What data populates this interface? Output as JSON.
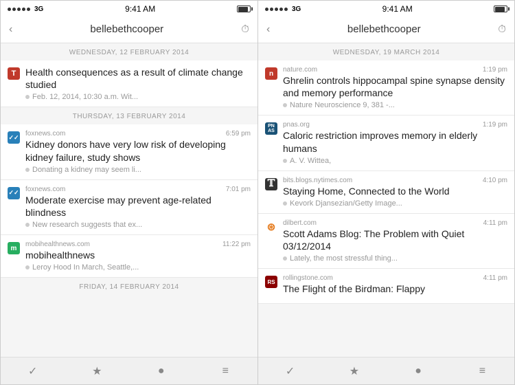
{
  "phone_left": {
    "status": {
      "signal_dots": 5,
      "network": "3G",
      "time": "9:41 AM"
    },
    "nav": {
      "back_label": "‹",
      "title": "bellebethcooper",
      "clock_icon": "⏱"
    },
    "sections": [
      {
        "date": "WEDNESDAY, 12 FEBRUARY 2014",
        "items": [
          {
            "icon_type": "red",
            "icon_label": "T",
            "source": "",
            "time": "",
            "title": "Health consequences as a result of climate change studied",
            "snippet": "Feb. 12, 2014, 10:30 a.m. Wit..."
          }
        ]
      },
      {
        "date": "THURSDAY, 13 FEBRUARY 2014",
        "items": [
          {
            "icon_type": "blue",
            "icon_label": "✓",
            "source": "foxnews.com",
            "time": "6:59 pm",
            "title": "Kidney donors have very low risk of developing kidney failure, study shows",
            "snippet": "Donating a kidney may seem li..."
          },
          {
            "icon_type": "blue",
            "icon_label": "✓",
            "source": "foxnews.com",
            "time": "7:01 pm",
            "title": "Moderate exercise may prevent age-related blindness",
            "snippet": "New research suggests that ex..."
          },
          {
            "icon_type": "green",
            "icon_label": "m",
            "source": "mobihealthnews.com",
            "time": "11:22 pm",
            "title": "mobihealthnews",
            "snippet": "Leroy Hood In March, Seattle,..."
          }
        ]
      },
      {
        "date": "FRIDAY, 14 FEBRUARY 2014",
        "items": []
      }
    ],
    "toolbar": {
      "check": "✓",
      "star": "★",
      "dot": "●",
      "menu": "≡"
    }
  },
  "phone_right": {
    "status": {
      "signal_dots": 5,
      "network": "3G",
      "time": "9:41 AM"
    },
    "nav": {
      "back_label": "‹",
      "title": "bellebethcooper",
      "clock_icon": "⏱"
    },
    "sections": [
      {
        "date": "WEDNESDAY, 19 MARCH 2014",
        "items": [
          {
            "icon_type": "red",
            "icon_label": "n",
            "source": "nature.com",
            "time": "1:19 pm",
            "title": "Ghrelin controls hippocampal spine synapse density and memory performance",
            "snippet": "Nature Neuroscience 9, 381 -..."
          },
          {
            "icon_type": "pnas",
            "icon_label": "PN\nAS",
            "source": "pnas.org",
            "time": "1:19 pm",
            "title": "Caloric restriction improves memory in elderly humans",
            "snippet": "A. V. Wittea,"
          },
          {
            "icon_type": "dark",
            "icon_label": "T",
            "source": "bits.blogs.nytimes.com",
            "time": "4:10 pm",
            "title": "Staying Home, Connected to the World",
            "snippet": "Kevork Djansezian/Getty Image..."
          },
          {
            "icon_type": "rss",
            "icon_label": "》",
            "source": "dilbert.com",
            "time": "4:11 pm",
            "title": "Scott Adams Blog: The Problem with Quiet 03/12/2014",
            "snippet": "Lately, the most stressful thing..."
          },
          {
            "icon_type": "rolling",
            "icon_label": "RS",
            "source": "rollingstone.com",
            "time": "4:11 pm",
            "title": "The Flight of the Birdman: Flappy",
            "snippet": ""
          }
        ]
      }
    ],
    "toolbar": {
      "check": "✓",
      "star": "★",
      "dot": "●",
      "menu": "≡"
    }
  }
}
